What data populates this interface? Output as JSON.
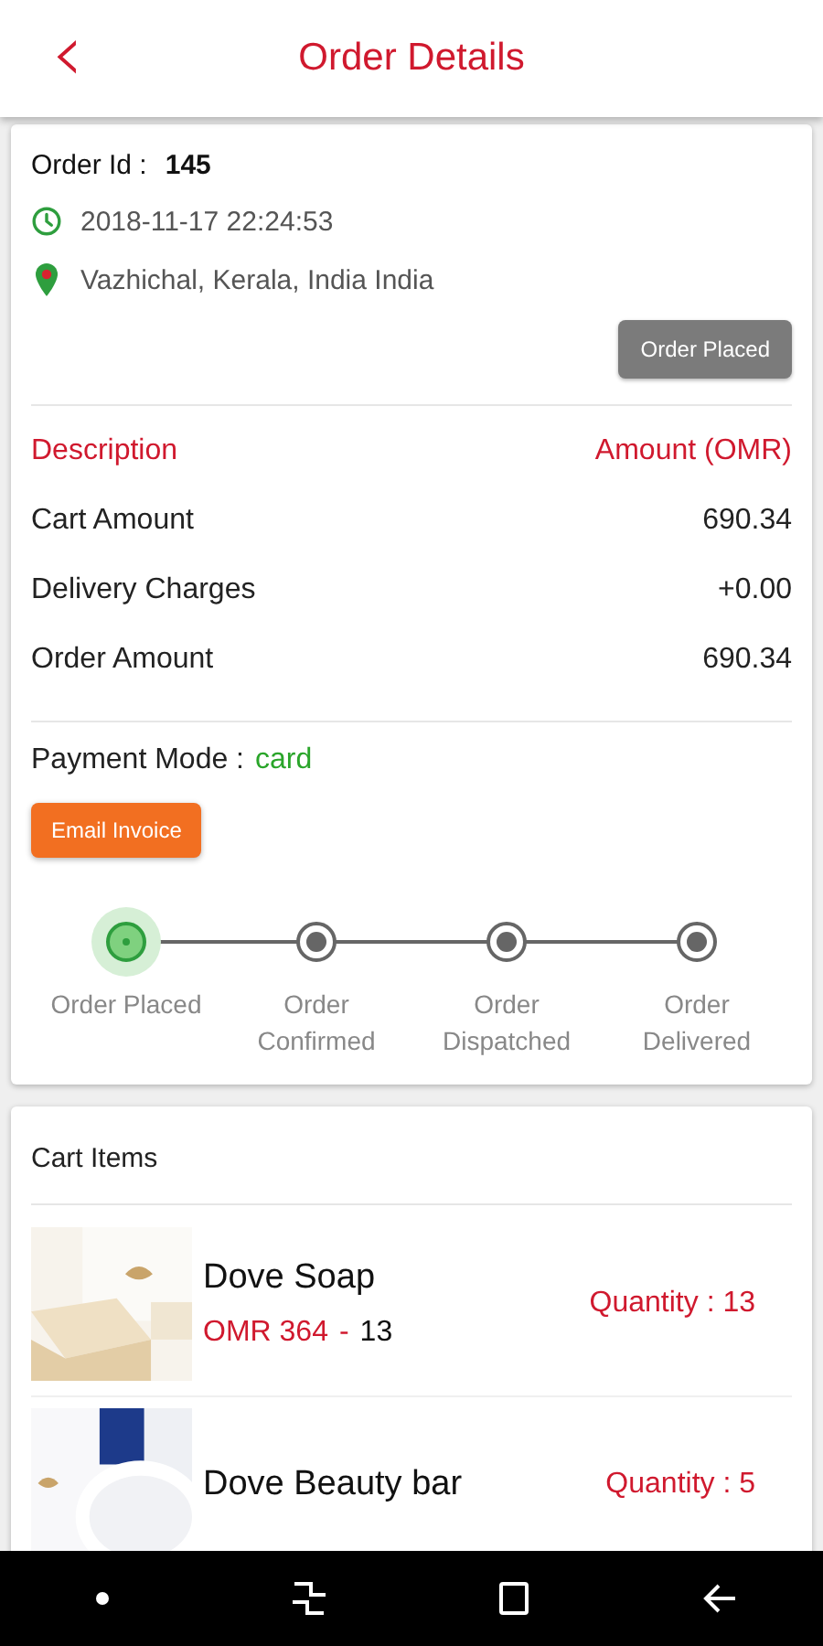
{
  "header": {
    "back_icon": "‹",
    "title": "Order Details"
  },
  "order": {
    "id_label": "Order Id :",
    "id": "145",
    "datetime": "2018-11-17 22:24:53",
    "address": "Vazhichal, Kerala, India  India",
    "status": "Order Placed"
  },
  "amounts": {
    "columns": [
      "Description",
      "Amount (OMR)"
    ],
    "rows": [
      {
        "label": "Cart Amount",
        "value": "690.34"
      },
      {
        "label": "Delivery Charges",
        "value": "+0.00"
      },
      {
        "label": "Order Amount",
        "value": "690.34"
      }
    ]
  },
  "payment": {
    "label": "Payment Mode :",
    "value": "card"
  },
  "email_button": "Email Invoice",
  "steps": [
    {
      "label": "Order Placed",
      "active": true
    },
    {
      "label": "Order Confirmed",
      "active": false
    },
    {
      "label": "Order Dispatched",
      "active": false
    },
    {
      "label": "Order Delivered",
      "active": false
    }
  ],
  "cart": {
    "title": "Cart Items",
    "items": [
      {
        "kind": "picture",
        "name": "Dove Soap",
        "price": "OMR 364",
        "separator": "-",
        "count": "13",
        "quantity": "Quantity : 13"
      },
      {
        "kind": "picture",
        "name": "Dove Beauty bar",
        "quantity": "Quantity : 5"
      }
    ]
  }
}
